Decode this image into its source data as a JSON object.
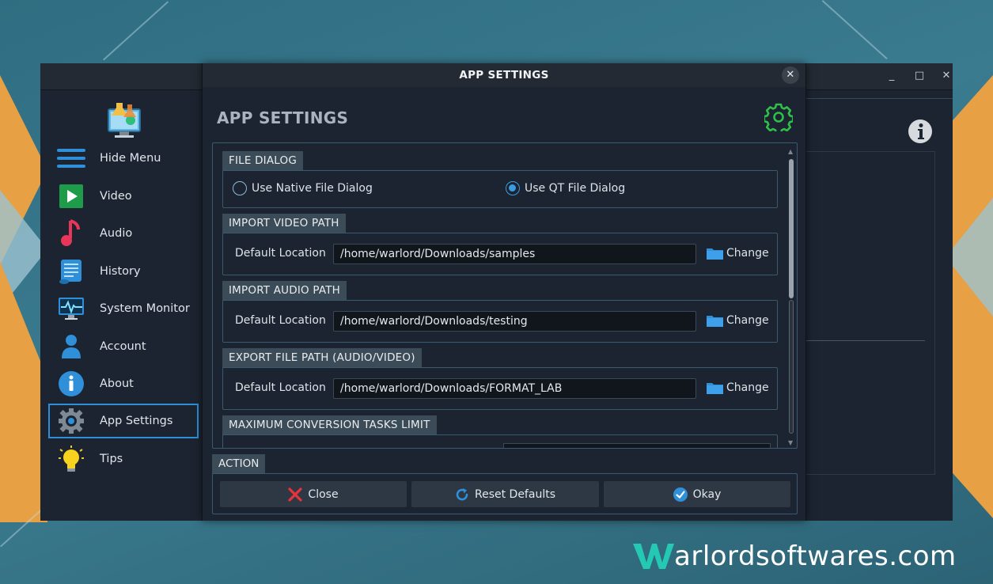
{
  "dialog": {
    "title": "APP SETTINGS",
    "page_title": "APP SETTINGS",
    "close_glyph": "✕"
  },
  "window_controls": {
    "minimize": "_",
    "maximize": "□",
    "close": "✕"
  },
  "sidebar": {
    "items": [
      {
        "label": "Hide Menu",
        "icon": "hamburger-menu-icon"
      },
      {
        "label": "Video",
        "icon": "video-play-icon"
      },
      {
        "label": "Audio",
        "icon": "music-note-icon"
      },
      {
        "label": "History",
        "icon": "history-scroll-icon"
      },
      {
        "label": "System Monitor",
        "icon": "system-monitor-icon"
      },
      {
        "label": "Account",
        "icon": "user-icon"
      },
      {
        "label": "About",
        "icon": "info-icon"
      },
      {
        "label": "App Settings",
        "icon": "gear-icon",
        "active": true
      },
      {
        "label": "Tips",
        "icon": "lightbulb-icon"
      }
    ]
  },
  "file_dialog": {
    "title": "FILE DIALOG",
    "native_label": "Use Native File Dialog",
    "qt_label": "Use QT File Dialog",
    "selected": "Use QT File Dialog"
  },
  "import_video": {
    "title": "IMPORT VIDEO PATH",
    "label": "Default Location",
    "path": "/home/warlord/Downloads/samples",
    "button": "Change"
  },
  "import_audio": {
    "title": "IMPORT AUDIO PATH",
    "label": "Default Location",
    "path": "/home/warlord/Downloads/testing",
    "button": "Change"
  },
  "export_path": {
    "title": "EXPORT FILE PATH (AUDIO/VIDEO)",
    "label": "Default Location",
    "path": "/home/warlord/Downloads/FORMAT_LAB",
    "button": "Change"
  },
  "max_tasks": {
    "title": "MAXIMUM CONVERSION TASKS LIMIT"
  },
  "action": {
    "title": "ACTION",
    "close_label": "Close",
    "reset_label": "Reset Defaults",
    "okay_label": "Okay"
  },
  "colors": {
    "accent": "#2f8fd8",
    "gear_green": "#2fbf4a",
    "close_red": "#e8323c",
    "folder_blue": "#2f8fd8"
  },
  "watermark": {
    "text": "arlordsoftwares.com",
    "logo_letter": "W"
  }
}
